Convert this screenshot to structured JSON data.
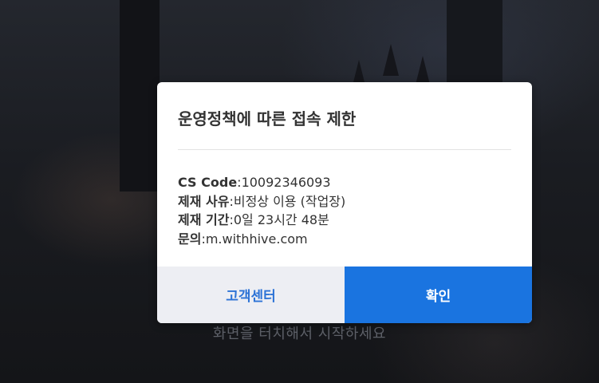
{
  "background": {
    "hint_text": "화면을 터치해서 시작하세요"
  },
  "dialog": {
    "title": "운영정책에 따른 접속 제한",
    "rows": [
      {
        "label": "CS Code",
        "value": "10092346093"
      },
      {
        "label": "제재 사유",
        "value": "비정상 이용 (작업장)"
      },
      {
        "label": "제재 기간",
        "value": "0일 23시간 48분"
      },
      {
        "label": "문의",
        "value": "m.withhive.com"
      }
    ],
    "separator": ":",
    "buttons": {
      "support_label": "고객센터",
      "confirm_label": "확인"
    }
  },
  "colors": {
    "confirm_button": "#1a74e0",
    "support_button_bg": "#edeef3",
    "support_button_text": "#2d73d6"
  }
}
